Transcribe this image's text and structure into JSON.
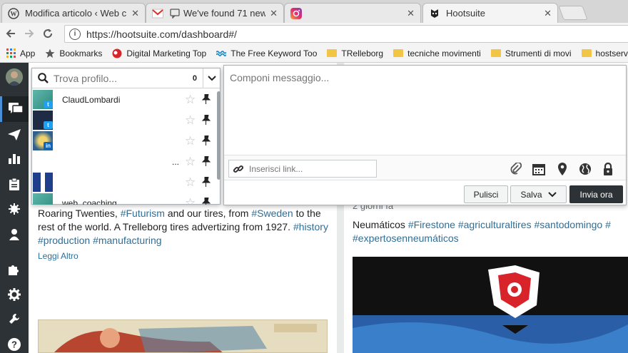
{
  "browser": {
    "tabs": [
      {
        "title": "Modifica articolo ‹ Web c",
        "icon": "wordpress-icon",
        "active": false
      },
      {
        "title": "We've found 71 new",
        "icon": "gmail-icon",
        "active": false
      },
      {
        "title": "",
        "icon": "instagram-icon",
        "active": false
      },
      {
        "title": "Hootsuite",
        "icon": "hootsuite-owl-icon",
        "active": true
      }
    ],
    "url": "https://hootsuite.com/dashboard#/",
    "bookmarks": [
      {
        "label": "App",
        "icon": "apps-grid-icon"
      },
      {
        "label": "Bookmarks",
        "icon": "star-icon"
      },
      {
        "label": "Digital Marketing Top",
        "icon": "red-circle-icon"
      },
      {
        "label": "The Free Keyword Too",
        "icon": "wave-icon"
      },
      {
        "label": "TRelleborg",
        "icon": "folder-icon"
      },
      {
        "label": "tecniche movimenti",
        "icon": "folder-icon"
      },
      {
        "label": "Strumenti di movi",
        "icon": "folder-icon"
      },
      {
        "label": "hostservic",
        "icon": "folder-icon"
      }
    ]
  },
  "composer": {
    "profile_search_placeholder": "Trova profilo...",
    "selected_count": "0",
    "profiles": [
      {
        "name": "ClaudLombardi",
        "network": "twitter"
      },
      {
        "name": "",
        "network": "twitter"
      },
      {
        "name": "",
        "network": "linkedin"
      },
      {
        "name": "...",
        "network": "none"
      },
      {
        "name": "",
        "network": "none"
      },
      {
        "name": "web_coaching",
        "network": "none"
      }
    ],
    "message_placeholder": "Componi messaggio...",
    "link_placeholder": "Inserisci link...",
    "buttons": {
      "clear": "Pulisci",
      "save": "Salva",
      "send": "Invia ora"
    }
  },
  "streams": {
    "left_post": {
      "text_plain_1": "Roaring Twenties, ",
      "tag_futurism": "#Futurism",
      "text_plain_2": " and our tires, from ",
      "tag_sweden": "#Sweden",
      "text_plain_3": " to the rest of the world. A Trelleborg tires advertizing from 1927.",
      "tag_history": "#history",
      "tag_production": "#production",
      "tag_manufacturing": "#manufacturing",
      "read_more": "Leggi Altro"
    },
    "right_post": {
      "time": "2 giorni fa",
      "text_plain": "Neumáticos ",
      "tag_firestone": "#Firestone",
      "tag_agri": "#agriculturaltires",
      "tag_sd": "#santodomingo",
      "tag_cut": "#",
      "tag_expertos": "#expertosenneumáticos"
    }
  },
  "colors": {
    "sidebar": "#2d3236",
    "hashtag": "#2f6e96",
    "active_accent": "#4a90d9"
  }
}
